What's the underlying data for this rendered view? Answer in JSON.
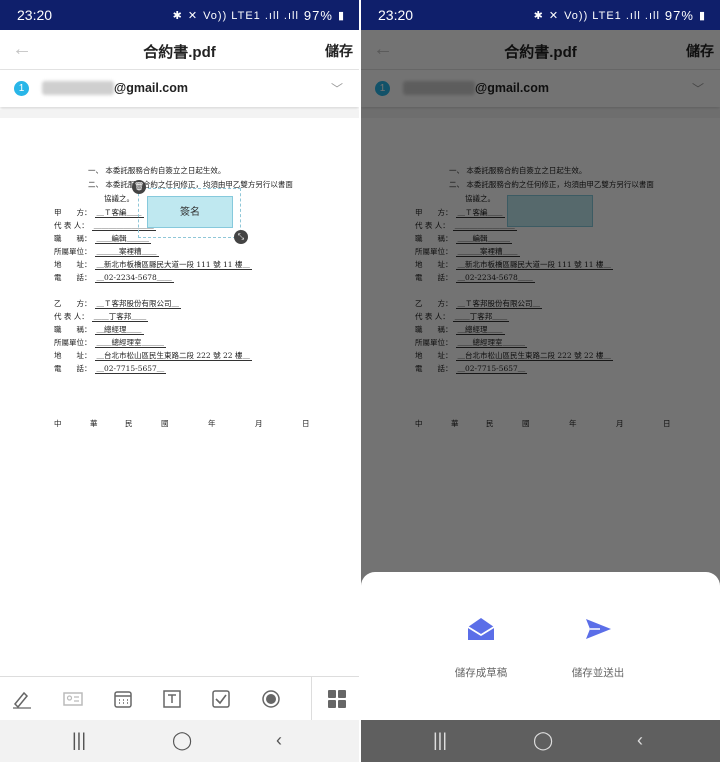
{
  "status_bar": {
    "time": "23:20",
    "signal_text": "Vo)) LTE1 .ıll .ıll",
    "battery": "97%"
  },
  "app_bar": {
    "title": "合約書.pdf",
    "save_label": "儲存"
  },
  "signer": {
    "index": "1",
    "email_suffix": "@gmail.com"
  },
  "document": {
    "clauses": [
      "一、 本委託服務合約自簽立之日起生效。",
      "二、 本委託服務合約之任何修正，均須由甲乙雙方另行以書面",
      "協議之。"
    ],
    "party_a": [
      {
        "label": "甲　　方：",
        "value": "＿Ｔ客編＿＿"
      },
      {
        "label": "代 表 人：",
        "value": "＿＿＿＿＿＿＿＿"
      },
      {
        "label": "職　　稱：",
        "value": "＿＿編輯＿＿＿"
      },
      {
        "label": "所屬單位：",
        "value": "＿＿＿案裡糟＿＿"
      },
      {
        "label": "地　　址：",
        "value": "＿新北市板橋區縣民大道一段 111 號 11 樓＿"
      },
      {
        "label": "電　　話：",
        "value": "＿02-2234-5678＿＿"
      }
    ],
    "party_b": [
      {
        "label": "乙　　方：",
        "value": "＿Ｔ客邦股份有限公司＿"
      },
      {
        "label": "代 表 人：",
        "value": "＿＿丁客邦＿＿"
      },
      {
        "label": "職　　稱：",
        "value": "＿總經理＿＿"
      },
      {
        "label": "所屬單位：",
        "value": "＿＿總經理室＿＿＿"
      },
      {
        "label": "地　　址：",
        "value": "＿台北市松山區民生東路二段 222 號 22 樓＿"
      },
      {
        "label": "電　　話：",
        "value": "＿02-7715-5657＿"
      }
    ],
    "date_line": [
      "中",
      "華",
      "民",
      "國",
      "年",
      "月",
      "日"
    ]
  },
  "signature_field": {
    "label": "簽名"
  },
  "toolbar": {
    "icons": [
      "signature-icon",
      "id-card-icon",
      "calendar-icon",
      "text-box-icon",
      "checkbox-icon",
      "radio-icon",
      "apps-grid-icon"
    ]
  },
  "bottom_sheet": {
    "draft_label": "儲存成草稿",
    "send_label": "儲存並送出",
    "accent_color": "#5b6ee8"
  },
  "colors": {
    "status_bar": "#0f1f6b",
    "signer_badge": "#29b6e8",
    "signature_fill": "#bfe8f0"
  }
}
